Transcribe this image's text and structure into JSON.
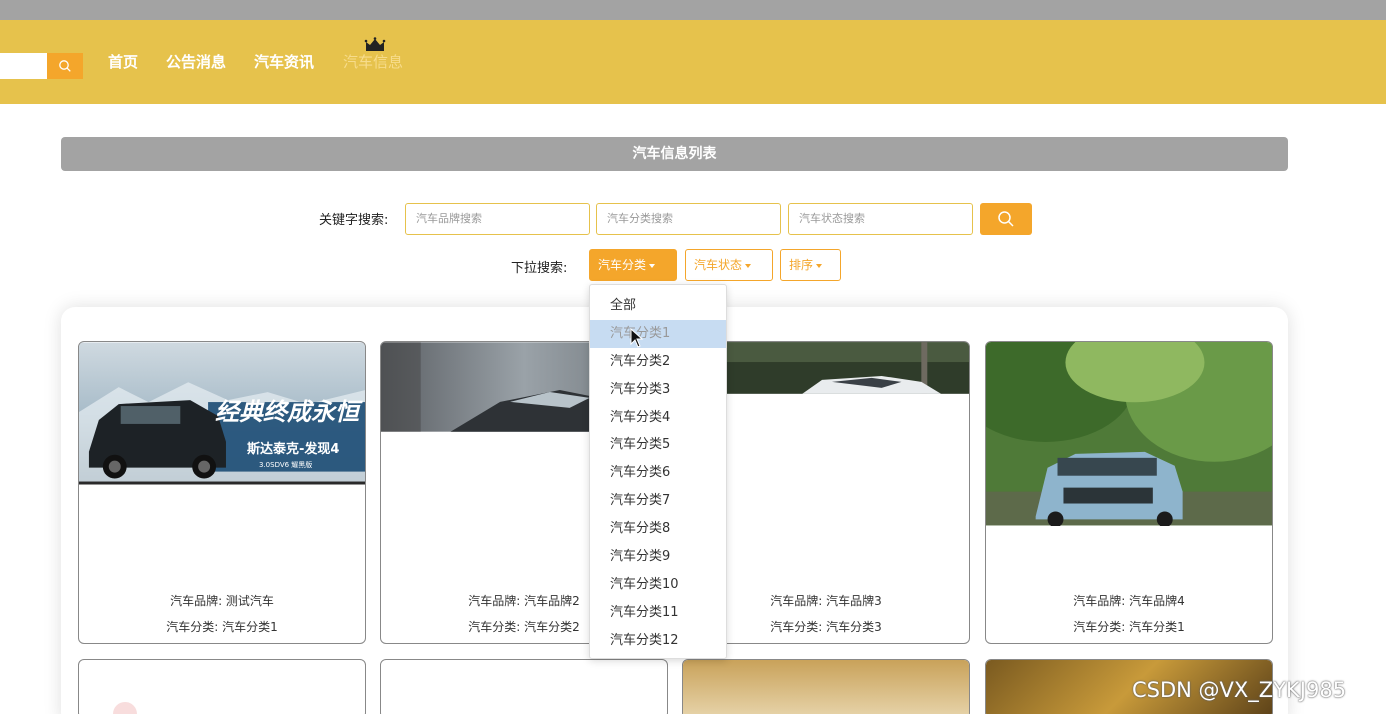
{
  "nav": {
    "items": [
      {
        "label": "首页"
      },
      {
        "label": "公告消息"
      },
      {
        "label": "汽车资讯"
      },
      {
        "label": "汽车信息"
      }
    ],
    "accent": "#e6c24c",
    "button_color": "#f4a62b"
  },
  "list": {
    "title": "汽车信息列表"
  },
  "search": {
    "keyword_label": "关键字搜索:",
    "brand_placeholder": "汽车品牌搜索",
    "category_placeholder": "汽车分类搜索",
    "status_placeholder": "汽车状态搜索",
    "dropdown_label": "下拉搜索:",
    "category_btn": "汽车分类",
    "status_btn": "汽车状态",
    "sort_btn": "排序"
  },
  "dropdown": {
    "options": [
      "全部",
      "汽车分类1",
      "汽车分类2",
      "汽车分类3",
      "汽车分类4",
      "汽车分类5",
      "汽车分类6",
      "汽车分类7",
      "汽车分类8",
      "汽车分类9",
      "汽车分类10",
      "汽车分类11",
      "汽车分类12"
    ],
    "hovered": "汽车分类1"
  },
  "cards": [
    {
      "brand": "汽车品牌: 测试汽车",
      "category": "汽车分类: 汽车分类1",
      "banner_title": "经典终成永恒",
      "banner_sub": "斯达泰克-发现4",
      "banner_small": "3.0SDV6 耀黑版"
    },
    {
      "brand": "汽车品牌: 汽车品牌2",
      "category": "汽车分类: 汽车分类2"
    },
    {
      "brand": "汽车品牌: 汽车品牌3",
      "category": "汽车分类: 汽车分类3"
    },
    {
      "brand": "汽车品牌: 汽车品牌4",
      "category": "汽车分类: 汽车分类1"
    }
  ],
  "watermark": "CSDN @VX_ZYKJ985"
}
